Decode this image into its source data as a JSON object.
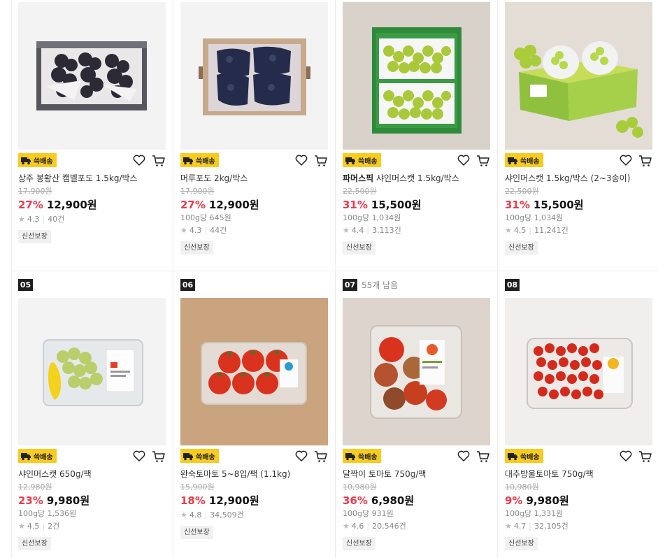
{
  "badge_label": "쓱배송",
  "currency_suffix": "원",
  "products": [
    {
      "rank": "",
      "stock_note": "",
      "brand": "",
      "name": "상주 봉황산 캠벨포도 1.5kg/박스",
      "original_price": "17,900원",
      "discount": "27%",
      "price": "12,900원",
      "unit_price": "",
      "rating": "4.3",
      "reviews": "40건",
      "tag": "신선보장",
      "image": "box-of-dark-grapes"
    },
    {
      "rank": "",
      "stock_note": "",
      "brand": "",
      "name": "머루포도 2kg/박스",
      "original_price": "17,900원",
      "discount": "27%",
      "price": "12,900원",
      "unit_price": "100g당 645원",
      "rating": "4.3",
      "reviews": "44건",
      "tag": "신선보장",
      "image": "box-of-bagged-grapes"
    },
    {
      "rank": "",
      "stock_note": "",
      "brand": "파머스픽",
      "name": "샤인머스캣 1.5kg/박스",
      "original_price": "22,500원",
      "discount": "31%",
      "price": "15,500원",
      "unit_price": "100g당 1,034원",
      "rating": "4.4",
      "reviews": "3,113건",
      "tag": "신선보장",
      "image": "green-box-shine-muscat"
    },
    {
      "rank": "",
      "stock_note": "",
      "brand": "",
      "name": "샤인머스캣 1.5kg/박스 (2~3송이)",
      "original_price": "22,500원",
      "discount": "31%",
      "price": "15,500원",
      "unit_price": "100g당 1,034원",
      "rating": "4.5",
      "reviews": "11,241건",
      "tag": "신선보장",
      "image": "gift-box-shine-muscat"
    },
    {
      "rank": "05",
      "stock_note": "",
      "brand": "",
      "name": "샤인머스캣 650g/팩",
      "original_price": "12,980원",
      "discount": "23%",
      "price": "9,980원",
      "unit_price": "100g당 1,536원",
      "rating": "4.5",
      "reviews": "2건",
      "tag": "신선보장",
      "image": "pack-shine-muscat"
    },
    {
      "rank": "06",
      "stock_note": "",
      "brand": "",
      "name": "완숙토마토 5~8입/팩 (1.1kg)",
      "original_price": "15,900원",
      "discount": "18%",
      "price": "12,900원",
      "unit_price": "",
      "rating": "4.8",
      "reviews": "34,509건",
      "tag": "신선보장",
      "image": "pack-ripe-tomatoes"
    },
    {
      "rank": "07",
      "stock_note": "55개 남음",
      "brand": "",
      "name": "달짝이 토마토 750g/팩",
      "original_price": "10,980원",
      "discount": "36%",
      "price": "6,980원",
      "unit_price": "100g당 931원",
      "rating": "4.6",
      "reviews": "20,546건",
      "tag": "신선보장",
      "image": "pack-mixed-tomatoes"
    },
    {
      "rank": "08",
      "stock_note": "",
      "brand": "",
      "name": "대추방울토마토 750g/팩",
      "original_price": "10,980원",
      "discount": "9%",
      "price": "9,980원",
      "unit_price": "100g당 1,331원",
      "rating": "4.7",
      "reviews": "32,105건",
      "tag": "신선보장",
      "image": "pack-cherry-tomatoes"
    }
  ],
  "colors": {
    "discount": "#f0384a",
    "badge": "#f8cc1e",
    "rank_bg": "#1f1f1f"
  }
}
